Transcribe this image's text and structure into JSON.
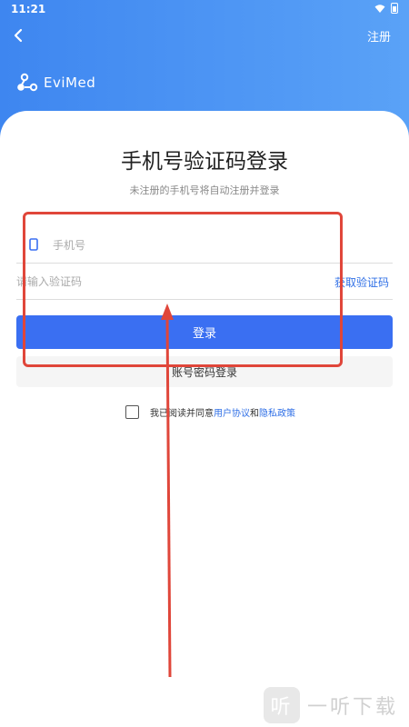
{
  "status_bar": {
    "time": "11:21"
  },
  "header": {
    "register_label": "注册"
  },
  "logo": {
    "name": "EviMed"
  },
  "login": {
    "title": "手机号验证码登录",
    "subtitle": "未注册的手机号将自动注册并登录",
    "phone_placeholder": "手机号",
    "code_placeholder": "请输入验证码",
    "get_code_label": "获取验证码",
    "login_button": "登录",
    "password_login_button": "账号密码登录",
    "agreement_prefix": "我已阅读并同意",
    "user_agreement": "用户协议",
    "and_text": "和",
    "privacy_policy": "隐私政策"
  },
  "watermark": {
    "text": "一听下载",
    "logo_char": "听"
  },
  "colors": {
    "accent": "#3a6ff2",
    "header_blue": "#4a90ee",
    "annotation_red": "#e0463a"
  },
  "icons": [
    "back-arrow-icon",
    "wifi-icon",
    "battery-icon",
    "evimed-logo-icon",
    "phone-icon",
    "checkbox-icon"
  ]
}
